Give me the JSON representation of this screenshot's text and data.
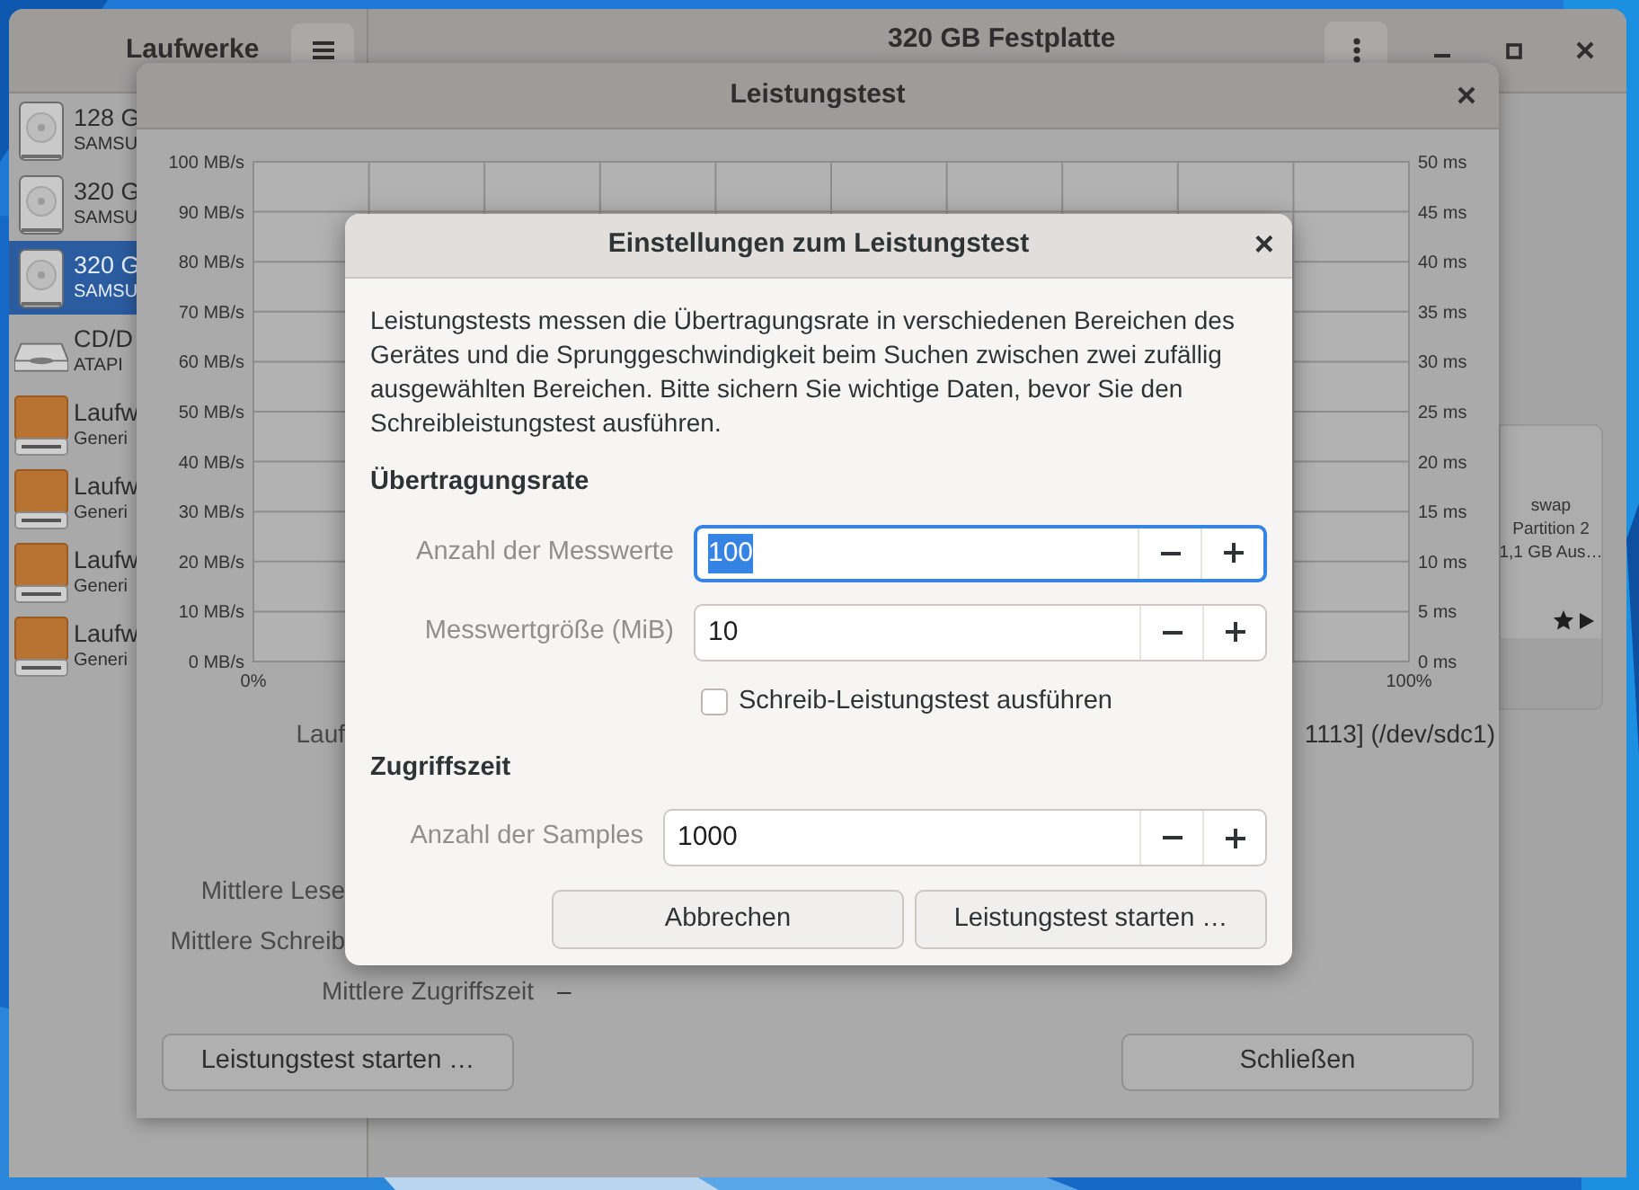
{
  "main_window": {
    "sidebar_title": "Laufwerke",
    "title": "320 GB Festplatte",
    "drives": [
      {
        "name": "128 G",
        "model": "SAMSU",
        "kind": "disk",
        "selected": false
      },
      {
        "name": "320 G",
        "model": "SAMSU",
        "kind": "disk",
        "selected": false
      },
      {
        "name": "320 G",
        "model": "SAMSU",
        "kind": "disk",
        "selected": true
      },
      {
        "name": "CD/D",
        "model": "ATAPI",
        "kind": "optical",
        "selected": false
      },
      {
        "name": "Laufw",
        "model": "Generi",
        "kind": "drive",
        "selected": false
      },
      {
        "name": "Laufw",
        "model": "Generi",
        "kind": "drive",
        "selected": false
      },
      {
        "name": "Laufw",
        "model": "Generi",
        "kind": "drive",
        "selected": false
      },
      {
        "name": "Laufw",
        "model": "Generi",
        "kind": "drive",
        "selected": false
      }
    ],
    "partition": {
      "name": "swap",
      "number": "Partition 2",
      "size": "1,1 GB Aus…"
    }
  },
  "benchmark_window": {
    "title": "Leistungstest",
    "chart": {
      "left_axis": [
        "100 MB/s",
        "90 MB/s",
        "80 MB/s",
        "70 MB/s",
        "60 MB/s",
        "50 MB/s",
        "40 MB/s",
        "30 MB/s",
        "20 MB/s",
        "10 MB/s",
        "0 MB/s"
      ],
      "right_axis": [
        "50 ms",
        "45 ms",
        "40 ms",
        "35 ms",
        "30 ms",
        "25 ms",
        "20 ms",
        "15 ms",
        "10 ms",
        "5 ms",
        "0 ms"
      ],
      "bottom_axis": [
        "0%",
        "100%"
      ]
    },
    "info": [
      {
        "label": "Lauf",
        "value": "1113] (/dev/sdc1)",
        "kind": "partial"
      },
      {
        "label": "Mittlere Lese",
        "kind": "partial"
      },
      {
        "label": "Mittlere Schreib",
        "kind": "partial"
      },
      {
        "label": "Mittlere Zugriffszeit",
        "value": "–",
        "kind": "full"
      }
    ],
    "buttons": [
      "Leistungstest starten …",
      "Schließen"
    ]
  },
  "dialog": {
    "title": "Einstellungen zum Leistungstest",
    "close": "×",
    "description": "Leistungstests messen die Übertragungsrate in verschiedenen Bereichen des Gerätes und die Sprunggeschwindigkeit beim Suchen zwischen zwei zufällig ausgewählten Bereichen. Bitte sichern Sie wichtige Daten, bevor Sie den Schreibleistungstest ausführen.",
    "sections": [
      {
        "heading": "Übertragungsrate",
        "fields": [
          {
            "label": "Anzahl der Messwerte",
            "value": "100",
            "focused": true
          },
          {
            "label": "Messwertgröße (MiB)",
            "value": "10",
            "focused": false
          }
        ],
        "checkbox": {
          "label": "Schreib-Leistungstest ausführen",
          "checked": false
        }
      },
      {
        "heading": "Zugriffszeit",
        "fields": [
          {
            "label": "Anzahl der Samples",
            "value": "1000",
            "focused": false
          }
        ]
      }
    ],
    "buttons": [
      "Abbrechen",
      "Leistungstest starten …"
    ]
  }
}
